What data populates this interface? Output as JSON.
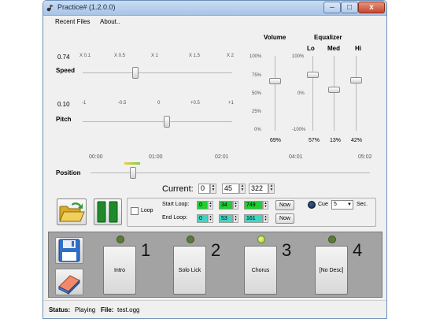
{
  "window": {
    "title": "Practice# (1.2.0.0)",
    "minimize": "–",
    "maximize": "□",
    "close": "x"
  },
  "menu": {
    "items": [
      "Recent Files",
      "About.."
    ]
  },
  "speed": {
    "value": "0.74",
    "label": "Speed",
    "ticks": [
      "X 0.1",
      "X 0.5",
      "X 1",
      "X 1.5",
      "X 2"
    ],
    "level": 0.74
  },
  "pitch": {
    "value": "0.10",
    "label": "Pitch",
    "ticks": [
      "-1",
      "-0.5",
      "0",
      "+0.5",
      "+1"
    ],
    "level": 0.1
  },
  "volume": {
    "label": "Volume",
    "scale": [
      "100%",
      "75%",
      "50%",
      "25%",
      "0%"
    ],
    "value": "69%"
  },
  "equalizer": {
    "label": "Equalizer",
    "scale": [
      "100%",
      "0%",
      "-100%"
    ],
    "bands": [
      {
        "name": "Lo",
        "value": "57%"
      },
      {
        "name": "Med",
        "value": "13%"
      },
      {
        "name": "Hi",
        "value": "42%"
      }
    ]
  },
  "position": {
    "label": "Position",
    "times": [
      "00:00",
      "01:00",
      "02:01",
      "04:01",
      "05:02"
    ],
    "fraction": 0.15
  },
  "current": {
    "label": "Current:",
    "minutes": "0",
    "seconds": "45",
    "millis": "322"
  },
  "loop": {
    "checkbox_label": "Loop",
    "start_label": "Start Loop:",
    "end_label": "End Loop:",
    "start": {
      "min": "0",
      "sec": "34",
      "ms": "749"
    },
    "end": {
      "min": "0",
      "sec": "53",
      "ms": "161"
    },
    "now_label": "Now"
  },
  "cue": {
    "label": "Cue",
    "value": "5",
    "unit": "Sec."
  },
  "markers": [
    {
      "label": "Intro",
      "number": "1",
      "active": false
    },
    {
      "label": "Solo Lick",
      "number": "2",
      "active": false
    },
    {
      "label": "Chorus",
      "number": "3",
      "active": true
    },
    {
      "label": "[No Desc]",
      "number": "4",
      "active": false
    }
  ],
  "status": {
    "status_label": "Status:",
    "status_value": "Playing",
    "file_label": "File:",
    "file_value": "test.ogg"
  },
  "colors": {
    "green_field": "#22cc33",
    "teal_field": "#3fd6c0",
    "panel_gray": "#a3a3a3"
  }
}
